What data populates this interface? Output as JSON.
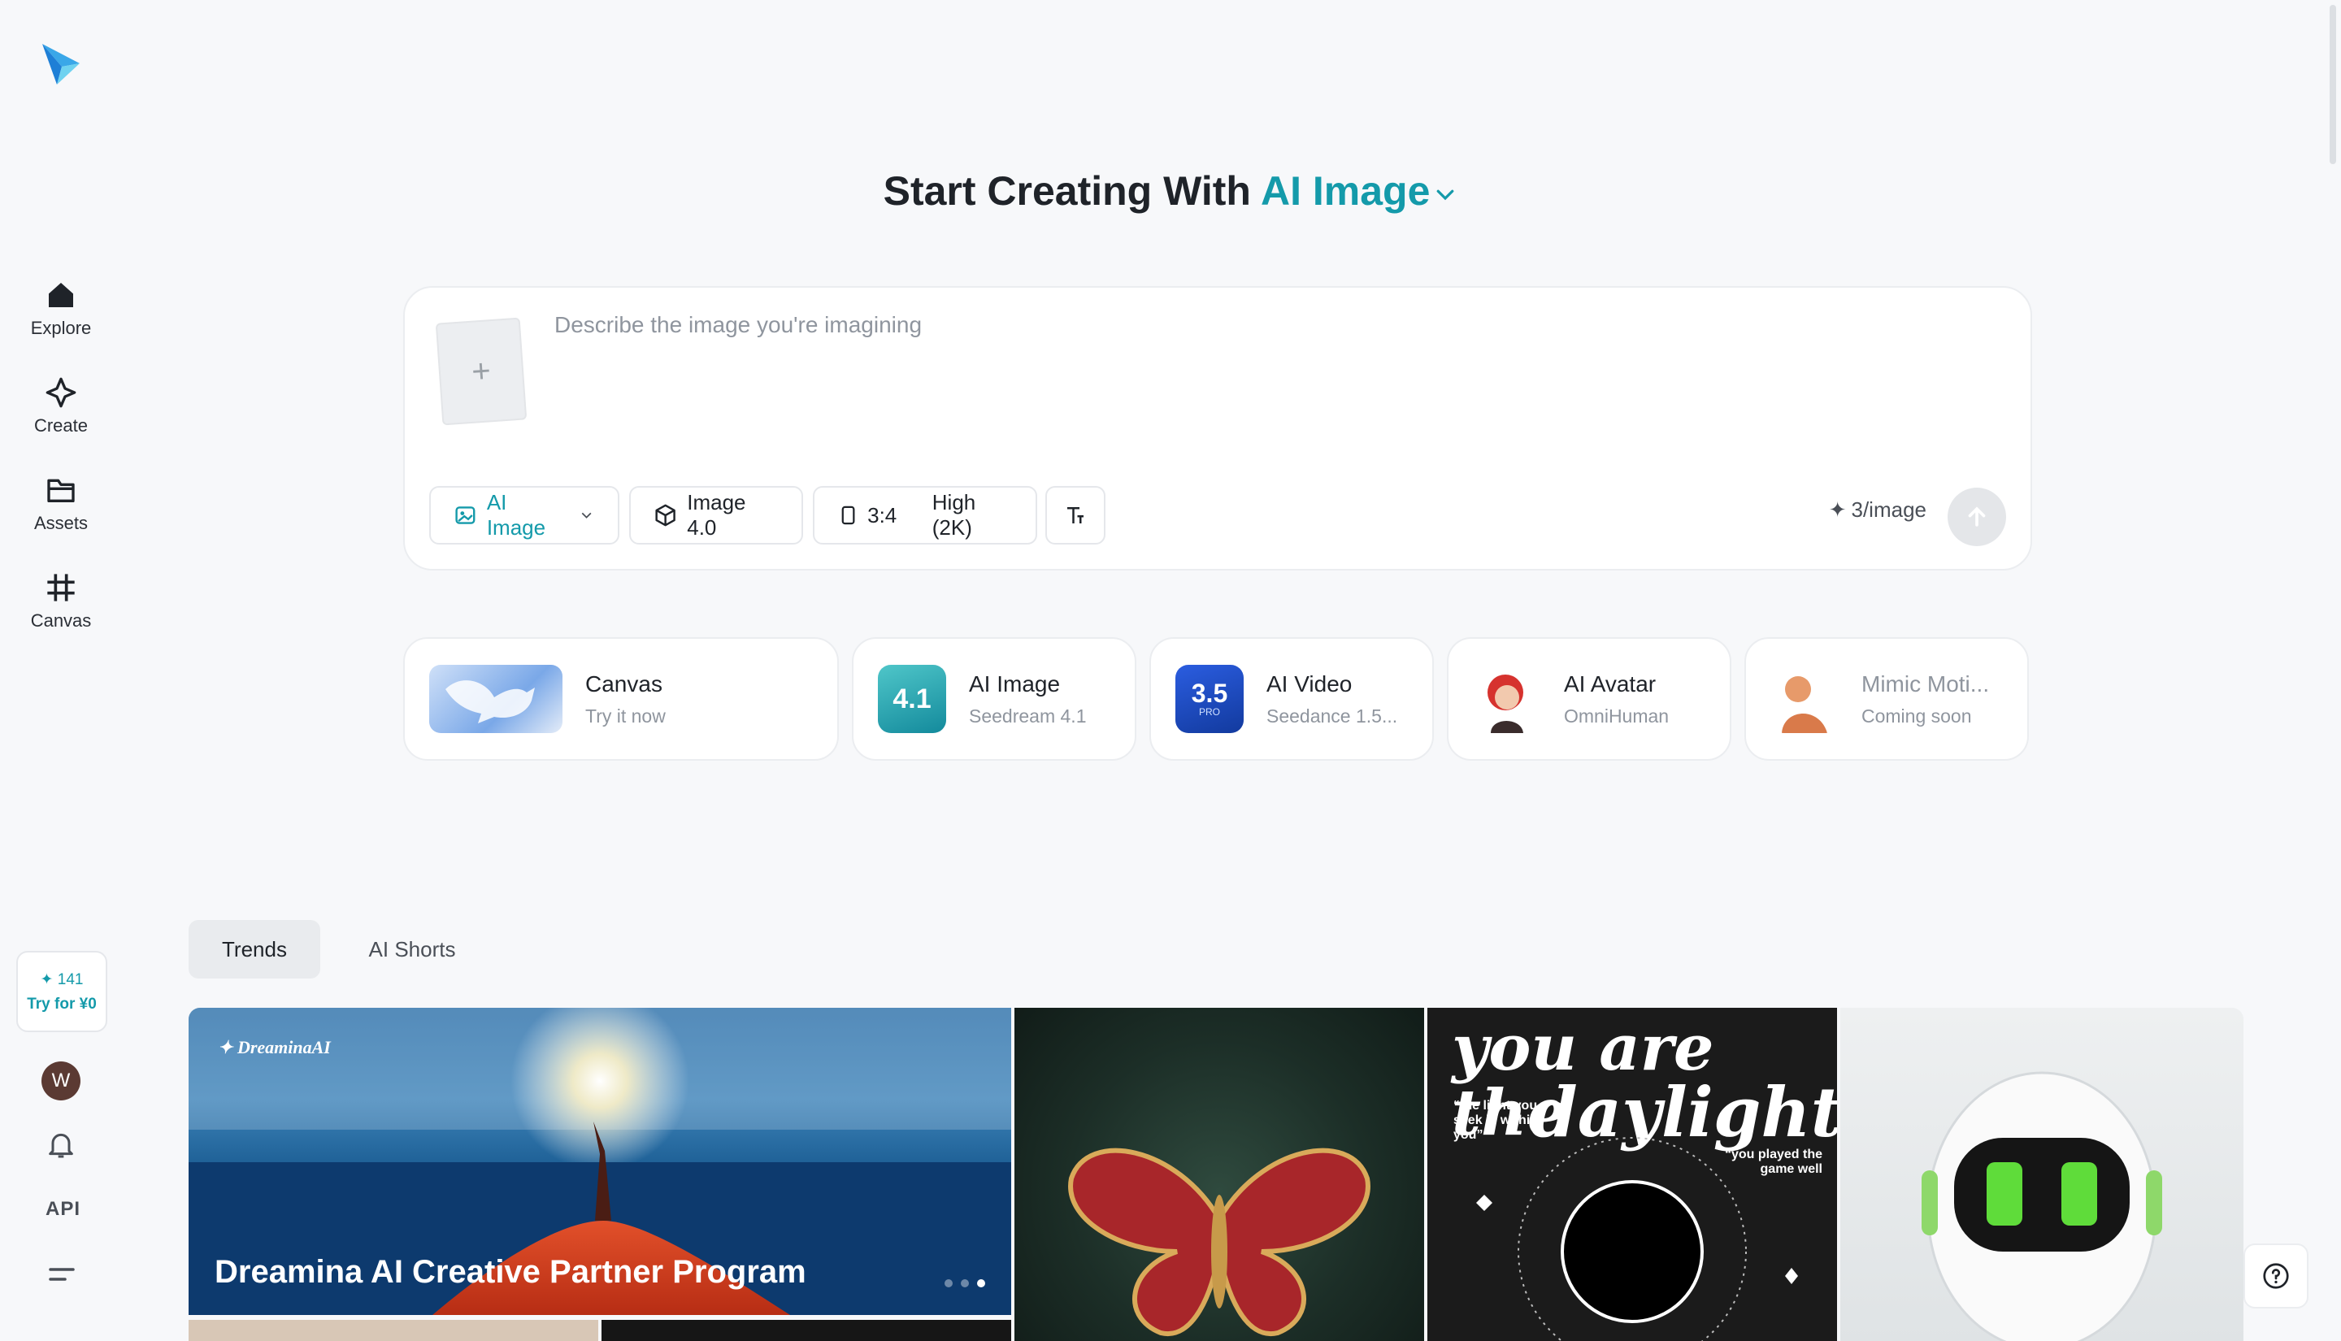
{
  "sidebar": {
    "nav": [
      {
        "label": "Explore",
        "icon": "home-icon"
      },
      {
        "label": "Create",
        "icon": "sparkle-icon"
      },
      {
        "label": "Assets",
        "icon": "folder-icon"
      },
      {
        "label": "Canvas",
        "icon": "frame-icon"
      }
    ],
    "credits": "141",
    "try_label": "Try for ¥0",
    "avatar_initial": "W",
    "api_label": "API"
  },
  "heading": {
    "prefix": "Start Creating With",
    "mode": "AI Image"
  },
  "prompt": {
    "placeholder": "Describe the image you're imagining",
    "value": "",
    "type_label": "AI Image",
    "model_label": "Image 4.0",
    "ratio_label": "3:4",
    "quality_label": "High (2K)",
    "cost_label": "3/image"
  },
  "tools": [
    {
      "name": "Canvas",
      "sub": "Try it now"
    },
    {
      "name": "AI Image",
      "sub": "Seedream 4.1",
      "badge": "4.1"
    },
    {
      "name": "AI Video",
      "sub": "Seedance 1.5...",
      "badge": "3.5",
      "badge_sub": "PRO"
    },
    {
      "name": "AI Avatar",
      "sub": "OmniHuman"
    },
    {
      "name": "Mimic Moti...",
      "sub": "Coming soon"
    }
  ],
  "tabs": {
    "trends": "Trends",
    "shorts": "AI Shorts"
  },
  "gallery": {
    "banner_brand": "DreaminaAI",
    "banner_title": "Dreamina AI Creative Partner Program",
    "poster_line1": "you are the",
    "poster_line2": "daylight",
    "poster_quote1": "“the light you seek is within you”",
    "poster_quote2": "“you played the game well"
  },
  "colors": {
    "accent": "#149aaa",
    "background": "#f7f8fa"
  }
}
